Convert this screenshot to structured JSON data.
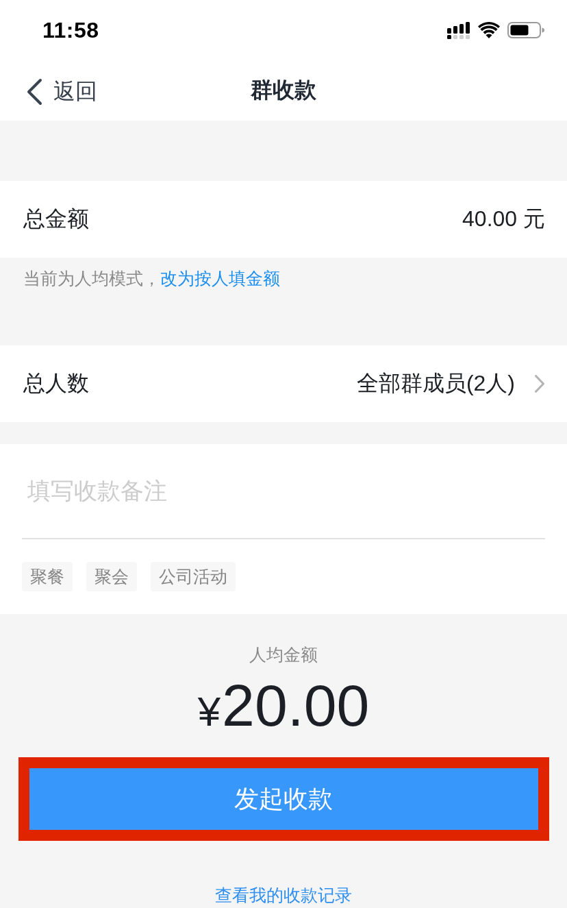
{
  "status_bar": {
    "time": "11:58"
  },
  "nav": {
    "back": "返回",
    "title": "群收款"
  },
  "total_amount": {
    "label": "总金额",
    "value": "40.00 元"
  },
  "mode_hint": {
    "text": "当前为人均模式，",
    "link": "改为按人填金额"
  },
  "total_people": {
    "label": "总人数",
    "value": "全部群成员(2人)"
  },
  "note": {
    "placeholder": "填写收款备注",
    "tags": [
      "聚餐",
      "聚会",
      "公司活动"
    ]
  },
  "per_person": {
    "label": "人均金额",
    "currency": "¥",
    "amount": "20.00"
  },
  "primary_button": {
    "label": "发起收款",
    "highlighted": true
  },
  "records_link": "查看我的收款记录"
}
